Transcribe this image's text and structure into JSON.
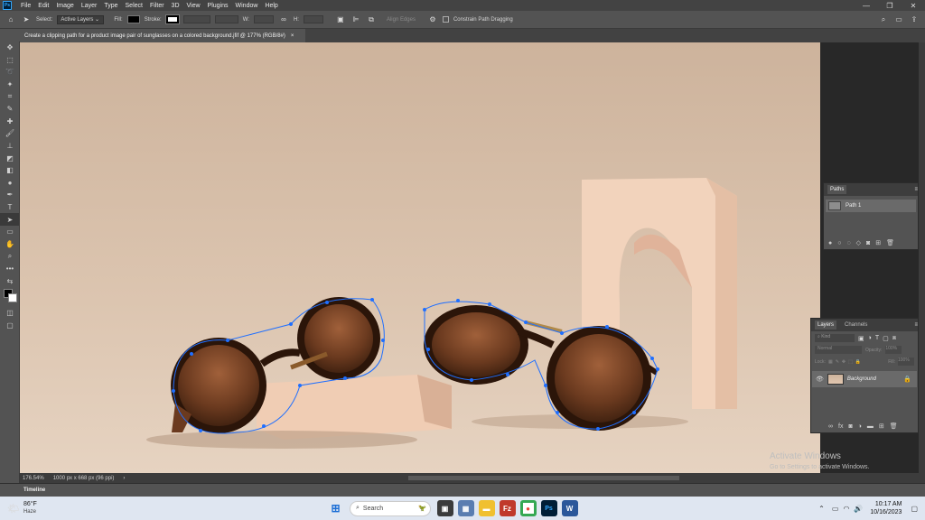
{
  "app": {
    "logo": "Ps"
  },
  "menu": [
    "File",
    "Edit",
    "Image",
    "Layer",
    "Type",
    "Select",
    "Filter",
    "3D",
    "View",
    "Plugins",
    "Window",
    "Help"
  ],
  "window_controls": [
    "—",
    "❐",
    "✕"
  ],
  "options": {
    "select_label": "Select:",
    "select_value": "Active Layers",
    "fill_label": "Fill:",
    "stroke_label": "Stroke:",
    "w_label": "W:",
    "h_label": "H:",
    "align_edges": "Align Edges",
    "constrain": "Constrain Path Dragging"
  },
  "document_tab": {
    "title": "Create a clipping path for a product image pair of sunglasses on a colored background.jfif @ 177% (RGB/8#)",
    "close": "×"
  },
  "paths_panel": {
    "tab": "Paths",
    "items": [
      {
        "name": "Path 1"
      }
    ]
  },
  "layers_panel": {
    "tabs": [
      "Layers",
      "Channels"
    ],
    "search_placeholder": "Kind",
    "blend_mode": "Normal",
    "opacity_label": "Opacity:",
    "opacity_value": "100%",
    "lock_label": "Lock:",
    "fill_label": "Fill:",
    "fill_value": "100%",
    "layers": [
      {
        "name": "Background"
      }
    ]
  },
  "status": {
    "zoom": "176.54%",
    "doc_info": "1000 px x 668 px (96 ppi)"
  },
  "timeline_label": "Timeline",
  "watermark": {
    "title": "Activate Windows",
    "subtitle": "Go to Settings to activate Windows."
  },
  "taskbar": {
    "weather_temp": "86°F",
    "weather_desc": "Haze",
    "search_placeholder": "Search",
    "time": "10:17 AM",
    "date": "10/16/2023"
  },
  "colors": {
    "accent": "#31a8ff",
    "canvas_bg": "#d7bfa8",
    "path_anchor": "#1f6fff"
  }
}
